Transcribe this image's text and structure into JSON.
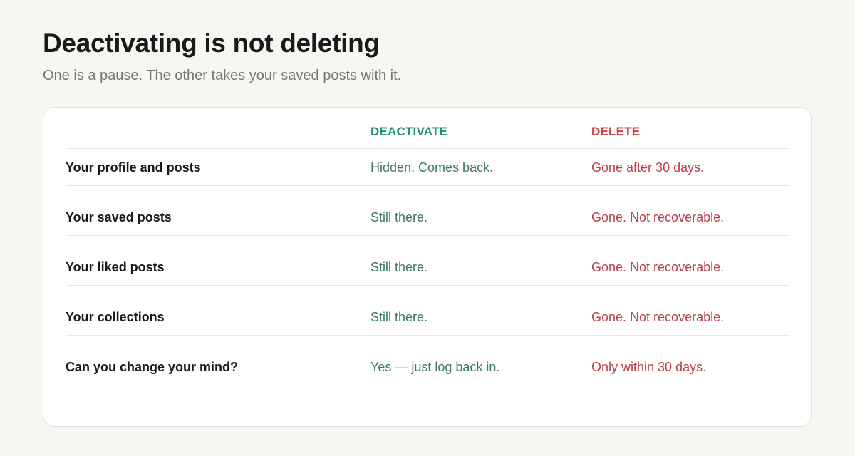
{
  "title": "Deactivating is not deleting",
  "subtitle": "One is a pause. The other takes your saved posts with it.",
  "table": {
    "headers": {
      "label": "",
      "deactivate": "DEACTIVATE",
      "delete": "DELETE"
    },
    "rows": [
      {
        "label": "Your profile and posts",
        "deactivate": "Hidden. Comes back.",
        "delete": "Gone after 30 days."
      },
      {
        "label": "Your saved posts",
        "deactivate": "Still there.",
        "delete": "Gone. Not recoverable."
      },
      {
        "label": "Your liked posts",
        "deactivate": "Still there.",
        "delete": "Gone. Not recoverable."
      },
      {
        "label": "Your collections",
        "deactivate": "Still there.",
        "delete": "Gone. Not recoverable."
      },
      {
        "label": "Can you change your mind?",
        "deactivate": "Yes — just log back in.",
        "delete": "Only within 30 days."
      }
    ]
  },
  "colors": {
    "background": "#f7f6f3",
    "deactivate_accent": "#1f9566",
    "delete_accent": "#d23b3b",
    "deactivate_text": "#3a7a5d",
    "delete_text": "#b8404a"
  }
}
